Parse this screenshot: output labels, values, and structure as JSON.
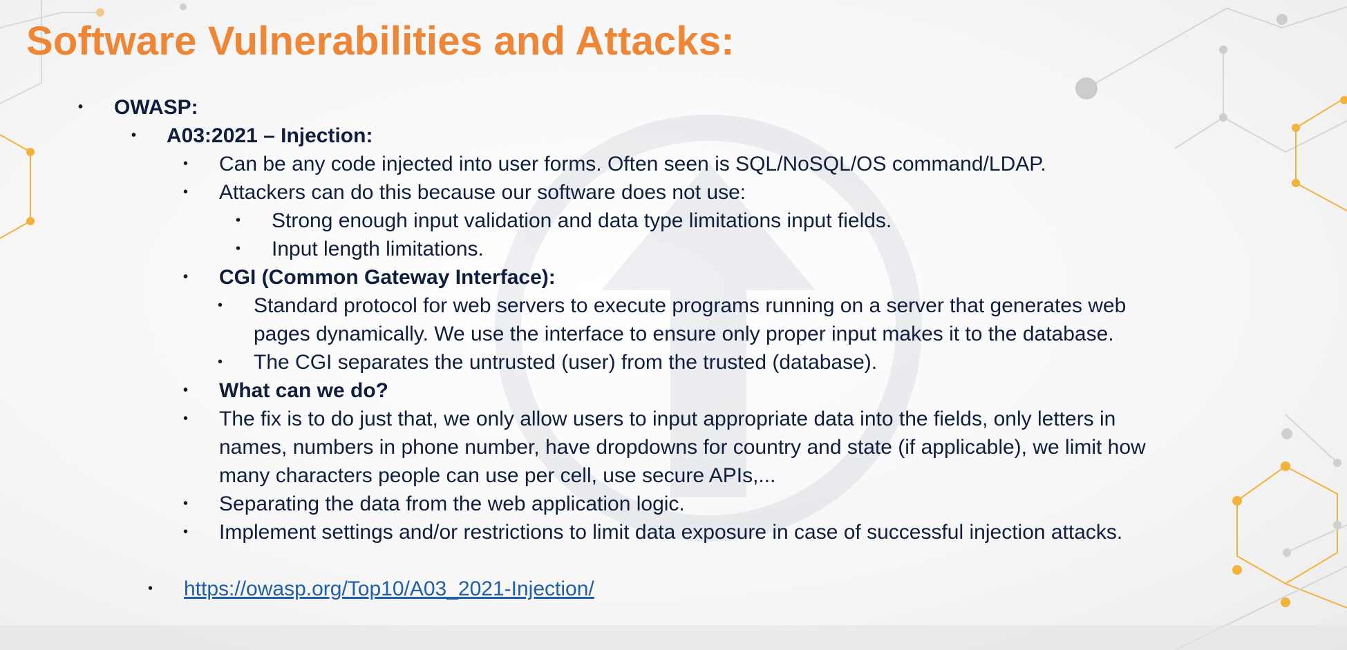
{
  "slide": {
    "title": "Software Vulnerabilities and Attacks:",
    "bullets": [
      {
        "text": "OWASP:",
        "bold": true,
        "level": 1
      },
      {
        "text": "A03:2021 – Injection:",
        "bold": true,
        "level": 2
      },
      {
        "text": "Can be any code injected into user forms. Often seen is SQL/NoSQL/OS command/LDAP.",
        "bold": false,
        "level": 3
      },
      {
        "text": "Attackers can do this because our software does not use:",
        "bold": false,
        "level": 3
      },
      {
        "text": "Strong enough input validation and data type limitations input fields.",
        "bold": false,
        "level": 4
      },
      {
        "text": "Input length limitations.",
        "bold": false,
        "level": 4
      },
      {
        "text": "CGI (Common Gateway Interface):",
        "bold": true,
        "level": 3
      },
      {
        "text": "Standard protocol for web servers to execute programs running on a server that generates web",
        "bold": false,
        "level": 4
      },
      {
        "text": "pages dynamically. We use the interface to ensure only proper input makes it to the database.",
        "bold": false,
        "level": 4
      },
      {
        "text": "The CGI separates the untrusted (user) from the trusted (database).",
        "bold": false,
        "level": 4
      },
      {
        "text": "What can we do?",
        "bold": true,
        "level": 3
      },
      {
        "text": "The fix is to do just that, we only allow users to input appropriate data into the fields, only letters in",
        "bold": false,
        "level": 3
      },
      {
        "text": "names, numbers in phone number, have dropdowns for country and state (if applicable), we limit how",
        "bold": false,
        "level": 3
      },
      {
        "text": "many characters people can use per cell, use secure APIs,...",
        "bold": false,
        "level": 3
      },
      {
        "text": "Separating the data from the web application logic.",
        "bold": false,
        "level": 3
      },
      {
        "text": "Implement settings and/or restrictions to limit data exposure in case of successful injection attacks.",
        "bold": false,
        "level": 3
      }
    ],
    "link": {
      "text": "https://owasp.org/Top10/A03_2021-Injection/"
    }
  },
  "colors": {
    "title": "#ee8636",
    "body_text": "#0f1e3c",
    "link": "#1f5ea8",
    "accent_orange": "#f2b23c",
    "decor_grey": "#c8c8c8"
  }
}
